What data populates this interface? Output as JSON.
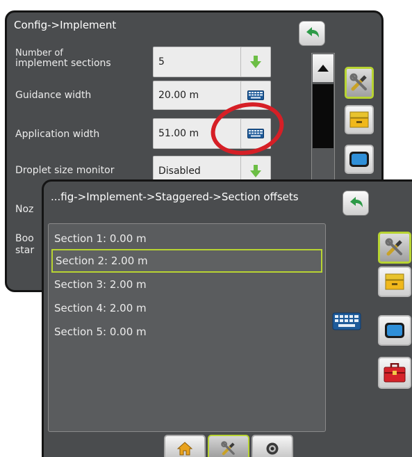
{
  "back_panel": {
    "title": "Config->Implement",
    "rows": [
      {
        "label_line1": "Number of",
        "label_line2": "implement sections",
        "value": "5",
        "action": "down-arrow-icon"
      },
      {
        "label_line1": "Guidance width",
        "label_line2": "",
        "value": "20.00 m",
        "action": "keyboard-icon"
      },
      {
        "label_line1": "Application width",
        "label_line2": "",
        "value": "51.00 m",
        "action": "keyboard-icon"
      },
      {
        "label_line1": "Droplet size monitor",
        "label_line2": "",
        "value": "Disabled",
        "action": "down-arrow-icon"
      },
      {
        "label_line1": "Noz",
        "label_line2": "",
        "value": "",
        "action": ""
      },
      {
        "label_line1": "Boo",
        "label_line2": "star",
        "value": "",
        "action": ""
      }
    ]
  },
  "front_panel": {
    "title": "...fig->Implement->Staggered->Section offsets",
    "sections": [
      {
        "label": "Section 1: 0.00 m",
        "selected": false
      },
      {
        "label": "Section 2: 2.00 m",
        "selected": true
      },
      {
        "label": "Section 3: 2.00 m",
        "selected": false
      },
      {
        "label": "Section 4: 2.00 m",
        "selected": false
      },
      {
        "label": "Section 5: 0.00 m",
        "selected": false
      }
    ]
  },
  "side_nav": [
    "tools-icon",
    "console-icon",
    "display-icon",
    "toolbox-icon"
  ],
  "bottom_tabs": [
    {
      "icon": "home-icon",
      "active": false
    },
    {
      "icon": "tools-icon",
      "active": true
    },
    {
      "icon": "camera-icon",
      "active": false
    }
  ],
  "colors": {
    "panel_bg": "#4a4c4e",
    "selection": "#b8d432",
    "annotation": "#d61f26",
    "arrow_green": "#6cbe45"
  }
}
